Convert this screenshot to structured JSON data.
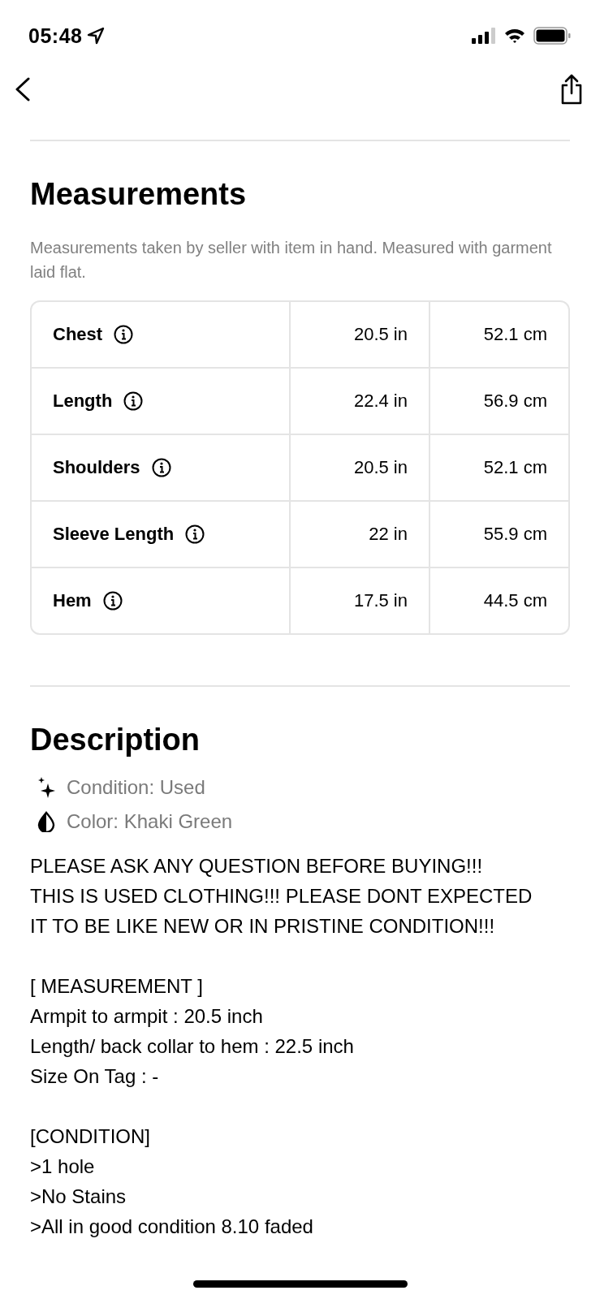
{
  "status_bar": {
    "time": "05:48"
  },
  "measurements": {
    "title": "Measurements",
    "note": "Measurements taken by seller with item in hand. Measured with garment laid flat.",
    "rows": [
      {
        "label": "Chest",
        "inches": "20.5 in",
        "cm": "52.1 cm"
      },
      {
        "label": "Length",
        "inches": "22.4 in",
        "cm": "56.9 cm"
      },
      {
        "label": "Shoulders",
        "inches": "20.5 in",
        "cm": "52.1 cm"
      },
      {
        "label": "Sleeve Length",
        "inches": "22 in",
        "cm": "55.9 cm"
      },
      {
        "label": "Hem",
        "inches": "17.5 in",
        "cm": "44.5 cm"
      }
    ]
  },
  "description": {
    "title": "Description",
    "attributes": [
      {
        "kind": "condition",
        "text": "Condition: Used"
      },
      {
        "kind": "color",
        "text": "Color: Khaki Green"
      }
    ],
    "paragraphs": [
      [
        "PLEASE ASK ANY QUESTION BEFORE BUYING!!!",
        "THIS IS USED CLOTHING!!! PLEASE DONT EXPECTED",
        "IT TO BE LIKE NEW OR IN PRISTINE CONDITION!!!"
      ],
      [
        "[ MEASUREMENT ]",
        "Armpit to armpit : 20.5 inch",
        "Length/ back collar to hem : 22.5 inch",
        "Size On Tag : -"
      ],
      [
        "[CONDITION]",
        ">1 hole",
        ">No Stains",
        ">All in good condition 8.10 faded"
      ]
    ]
  }
}
